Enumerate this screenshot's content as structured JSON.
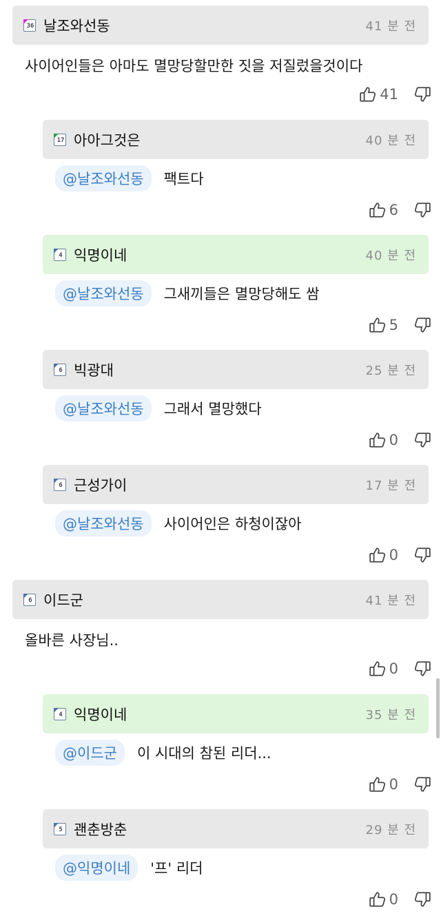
{
  "comments": [
    {
      "level": "36",
      "level_color": "pink",
      "nickname": "날조와선동",
      "time": "41 분 전",
      "text": "사이어인들은 아마도 멸망당할만한 짓을 저질렀을것이다",
      "upvotes": "41"
    },
    {
      "level": "17",
      "level_color": "green",
      "nickname": "아아그것은",
      "time": "40 분 전",
      "mention": "@날조와선동",
      "text": "팩트다",
      "upvotes": "6"
    },
    {
      "level": "4",
      "level_color": "blue",
      "nickname": "익명이네",
      "time": "40 분 전",
      "mention": "@날조와선동",
      "text": "그새끼들은 멸망당해도 쌈",
      "upvotes": "5"
    },
    {
      "level": "6",
      "level_color": "blue",
      "nickname": "빅광대",
      "time": "25 분 전",
      "mention": "@날조와선동",
      "text": "그래서 멸망했다",
      "upvotes": "0"
    },
    {
      "level": "6",
      "level_color": "blue",
      "nickname": "근성가이",
      "time": "17 분 전",
      "mention": "@날조와선동",
      "text": "사이어인은 하청이잖아",
      "upvotes": "0"
    },
    {
      "level": "6",
      "level_color": "blue",
      "nickname": "이드군",
      "time": "41 분 전",
      "text": "올바른 사장님..",
      "upvotes": "0"
    },
    {
      "level": "4",
      "level_color": "blue",
      "nickname": "익명이네",
      "time": "35 분 전",
      "mention": "@이드군",
      "text": "이 시대의 참된 리더...",
      "upvotes": "0"
    },
    {
      "level": "5",
      "level_color": "blue",
      "nickname": "괜춘방춘",
      "time": "29 분 전",
      "mention": "@익명이네",
      "text": "'프' 리더",
      "upvotes": "0"
    }
  ],
  "icons": {
    "upvote": "thumbs-up-icon",
    "downvote": "thumbs-down-icon"
  },
  "colors": {
    "header_bg": "#e8e8e8",
    "highlight_bg": "#dff5dc",
    "mention_text": "#3b7fc4",
    "mention_bg": "#eaf2fb"
  }
}
